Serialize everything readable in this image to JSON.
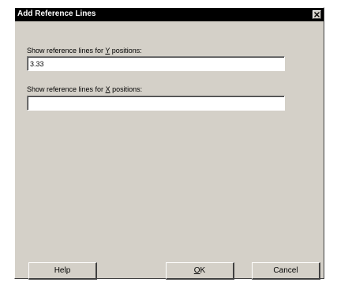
{
  "window": {
    "title": "Add Reference Lines",
    "close_icon": "close-icon"
  },
  "y_positions": {
    "label_prefix": "Show reference lines for ",
    "label_mnemonic": "Y",
    "label_suffix": " positions:",
    "value": "3.33"
  },
  "x_positions": {
    "label_prefix": "Show reference lines for ",
    "label_mnemonic": "X",
    "label_suffix": " positions:",
    "value": ""
  },
  "buttons": {
    "help": "Help",
    "ok_mnemonic": "O",
    "ok_rest": "K",
    "cancel": "Cancel"
  }
}
